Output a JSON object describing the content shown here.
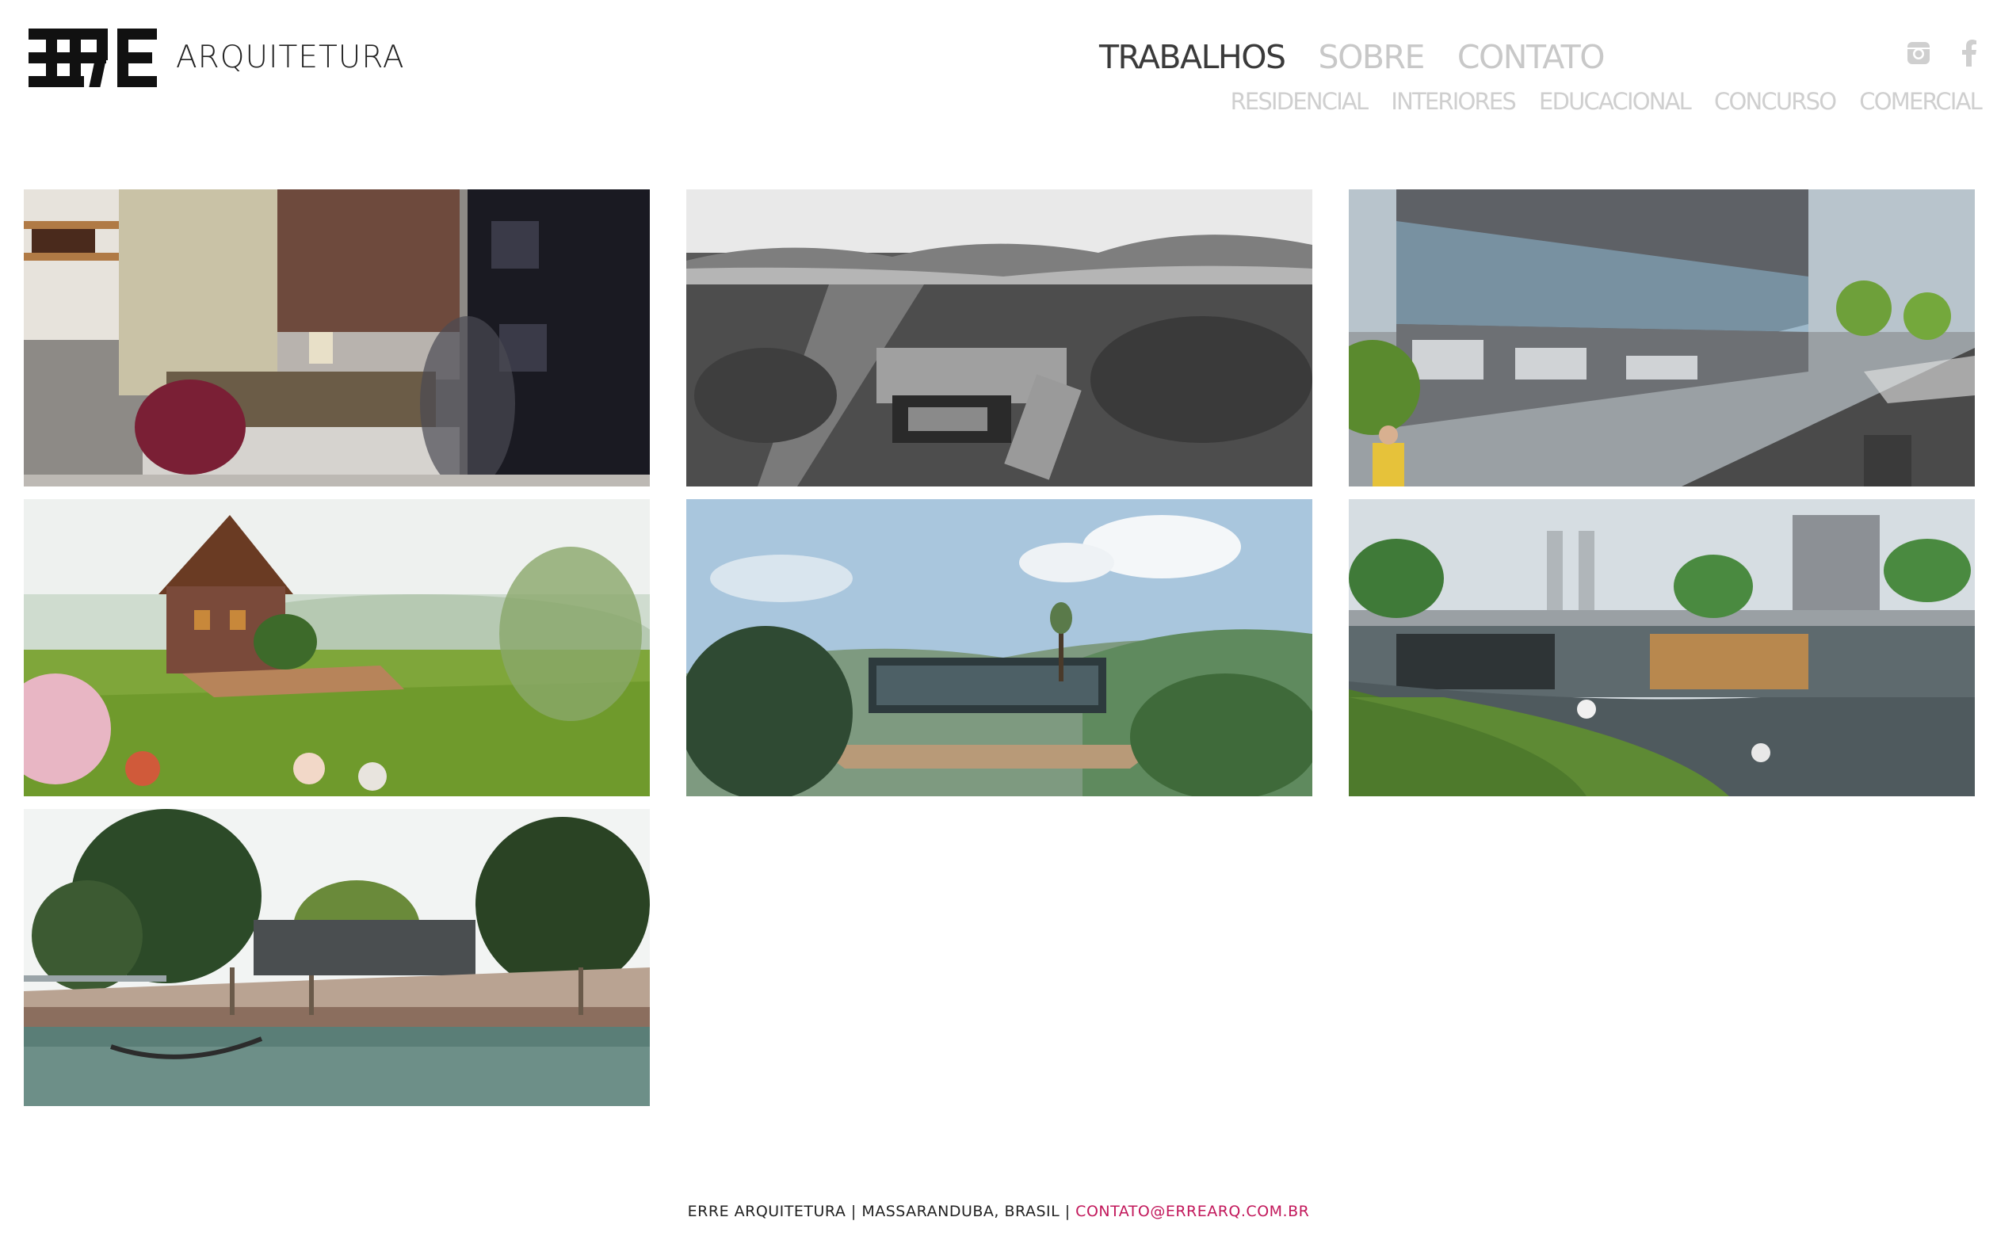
{
  "brand": {
    "mark": "ERRE",
    "name": "ARQUITETURA"
  },
  "nav": {
    "items": [
      {
        "label": "TRABALHOS",
        "active": true
      },
      {
        "label": "SOBRE",
        "active": false
      },
      {
        "label": "CONTATO",
        "active": false
      }
    ],
    "social": [
      "instagram-icon",
      "facebook-icon"
    ]
  },
  "categories": [
    "RESIDENCIAL",
    "INTERIORES",
    "EDUCACIONAL",
    "CONCURSO",
    "COMERCIAL"
  ],
  "projects": [
    {
      "scene": "interior-bedroom"
    },
    {
      "scene": "aerial-campus"
    },
    {
      "scene": "commercial-building"
    },
    {
      "scene": "house-meadow"
    },
    {
      "scene": "forest-pavilion"
    },
    {
      "scene": "urban-walkway"
    },
    {
      "scene": "riverside-plaza"
    }
  ],
  "footer": {
    "text": "ERRE ARQUITETURA | MASSARANDUBA, BRASIL | ",
    "email": "CONTATO@ERREARQ.COM.BR"
  },
  "colors": {
    "nav_active": "#3a3a3a",
    "nav_inactive": "#c8c8c8",
    "email_link": "#c2185b"
  }
}
